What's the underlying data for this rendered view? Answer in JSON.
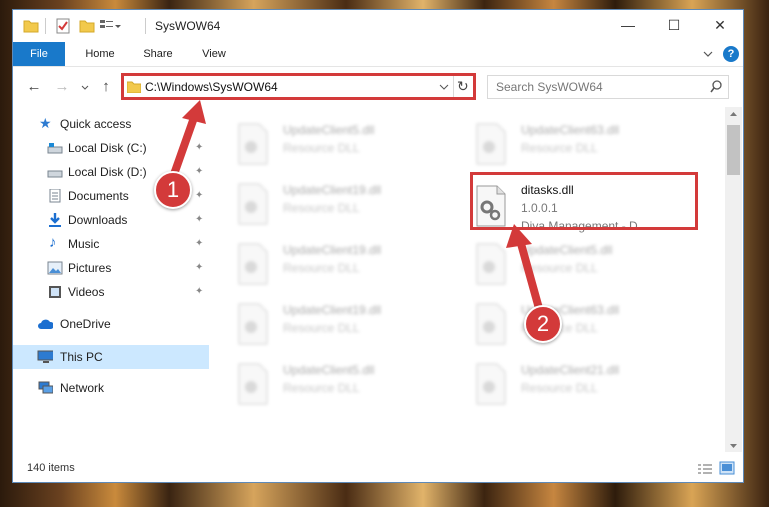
{
  "window": {
    "title": "SysWOW64",
    "controls": {
      "minimize": "—",
      "maximize": "☐",
      "close": "✕"
    }
  },
  "ribbon": {
    "tabs": [
      "File",
      "Home",
      "Share",
      "View"
    ],
    "collapse_icon": "chevron-down-icon",
    "help_icon": "help-icon",
    "help_glyph": "?"
  },
  "address_bar": {
    "path": "C:\\Windows\\SysWOW64",
    "search_placeholder": "Search SysWOW64"
  },
  "sidebar": {
    "items": [
      {
        "label": "Quick access",
        "icon": "star-icon",
        "pinned": false
      },
      {
        "label": "Local Disk (C:)",
        "icon": "drive-icon",
        "pinned": true
      },
      {
        "label": "Local Disk (D:)",
        "icon": "drive-icon",
        "pinned": true
      },
      {
        "label": "Documents",
        "icon": "documents-icon",
        "pinned": true
      },
      {
        "label": "Downloads",
        "icon": "download-icon",
        "pinned": true
      },
      {
        "label": "Music",
        "icon": "music-icon",
        "pinned": true
      },
      {
        "label": "Pictures",
        "icon": "pictures-icon",
        "pinned": true
      },
      {
        "label": "Videos",
        "icon": "videos-icon",
        "pinned": true
      },
      {
        "label": "OneDrive",
        "icon": "cloud-icon",
        "pinned": false
      },
      {
        "label": "This PC",
        "icon": "computer-icon",
        "pinned": false
      },
      {
        "label": "Network",
        "icon": "network-icon",
        "pinned": false
      }
    ],
    "pin_glyph": "📌"
  },
  "files": {
    "left_column": [
      {
        "name": "UpdateClient5.dll",
        "desc": "Resource DLL"
      },
      {
        "name": "UpdateClient19.dll",
        "desc": "Resource DLL"
      },
      {
        "name": "UpdateClient19.dll",
        "desc": "Resource DLL"
      },
      {
        "name": "UpdateClient19.dll",
        "desc": "Resource DLL"
      },
      {
        "name": "UpdateClient5.dll",
        "desc": "Resource DLL"
      }
    ],
    "right_column": [
      {
        "name": "UpdateClient63.dll",
        "desc": "Resource DLL"
      },
      {
        "name": "ditasks.dll",
        "version": "1.0.0.1",
        "desc": "Diva Management - D...",
        "highlighted": true
      },
      {
        "name": "UpdateClient5.dll",
        "desc": "Resource DLL"
      },
      {
        "name": "UpdateClient63.dll",
        "desc": "Resource DLL"
      },
      {
        "name": "UpdateClient21.dll",
        "desc": "Resource DLL"
      }
    ]
  },
  "status_bar": {
    "item_count": "140 items"
  },
  "annotations": {
    "callout_1": "1",
    "callout_2": "2",
    "color": "#d33a3a"
  },
  "colors": {
    "accent": "#1979ca",
    "selection": "#cce8ff"
  }
}
